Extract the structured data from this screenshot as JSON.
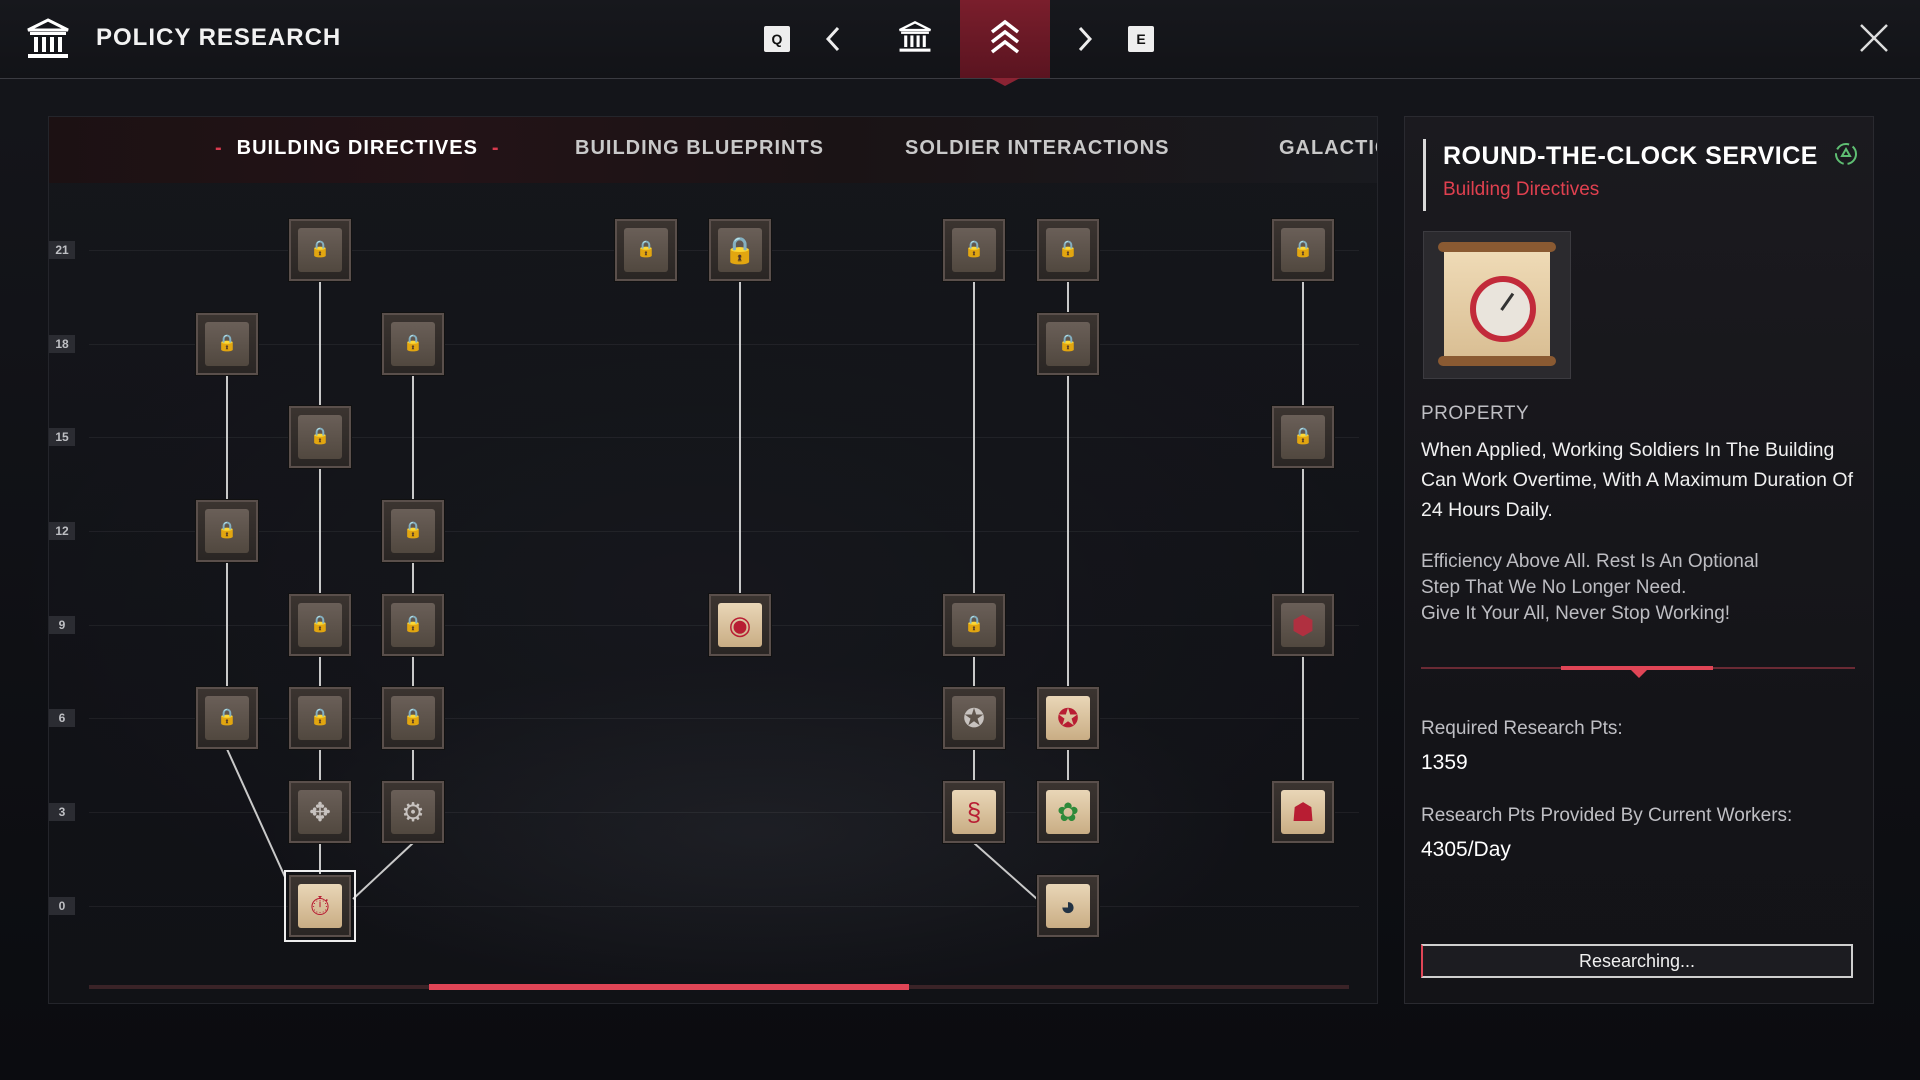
{
  "header": {
    "title": "POLICY RESEARCH",
    "icon": "bank-icon",
    "prev_key": "Q",
    "next_key": "E",
    "nav_items": [
      {
        "icon": "bank-icon",
        "active": false
      },
      {
        "icon": "rank-chevrons-icon",
        "active": true
      }
    ]
  },
  "tree": {
    "tabs": [
      {
        "label": "BUILDING DIRECTIVES",
        "active": true
      },
      {
        "label": "BUILDING BLUEPRINTS",
        "active": false
      },
      {
        "label": "SOLDIER INTERACTIONS",
        "active": false
      },
      {
        "label": "GALACTIC",
        "active": false
      }
    ],
    "row_levels": [
      "21",
      "18",
      "15",
      "12",
      "9",
      "6",
      "3",
      "0"
    ]
  },
  "detail": {
    "title": "ROUND-THE-CLOCK SERVICE",
    "category": "Building Directives",
    "image_icon": "clock-scroll-icon",
    "property_label": "PROPERTY",
    "description": "When Applied, Working Soldiers In The Building Can Work Overtime, With A Maximum Duration Of 24 Hours Daily.",
    "flavor": "Efficiency Above All. Rest Is An Optional\nStep That We No Longer Need.\nGive It Your All, Never Stop Working!",
    "required_label": "Required Research Pts:",
    "required_value": "1359",
    "provided_label": "Research Pts Provided By Current Workers:",
    "provided_value": "4305/Day",
    "button_label": "Researching..."
  },
  "colors": {
    "accent": "#e04556",
    "category": "#e0404f",
    "background": "#0d0e12"
  }
}
